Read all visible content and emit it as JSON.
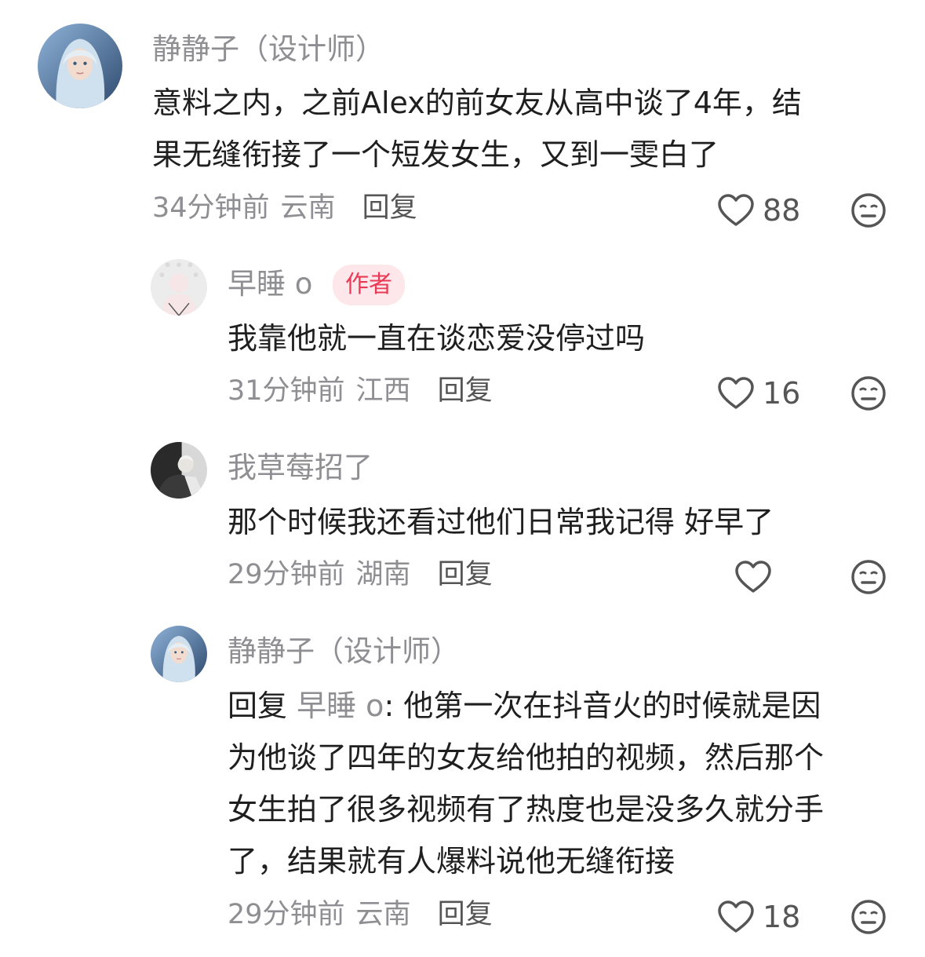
{
  "comments": [
    {
      "username": "静静子（设计师）",
      "text_lines": [
        "意料之内，之前Alex的前女友从高中谈了4年，结",
        "果无缝衔接了一个短发女生，又到一雯白了"
      ],
      "time": "34分钟前",
      "location": "云南",
      "reply_label": "回复",
      "likes": "88",
      "like_icon": "heart-outline-icon",
      "dislike_icon": "meh-face-icon"
    },
    {
      "username": "早睡 o",
      "badge": "作者",
      "text_lines": [
        "我靠他就一直在谈恋爱没停过吗"
      ],
      "time": "31分钟前",
      "location": "江西",
      "reply_label": "回复",
      "likes": "16"
    },
    {
      "username": "我草莓招了",
      "text_lines": [
        "那个时候我还看过他们日常我记得 好早了"
      ],
      "time": "29分钟前",
      "location": "湖南",
      "reply_label": "回复",
      "likes": ""
    },
    {
      "username": "静静子（设计师）",
      "reply_prefix": "回复 ",
      "reply_target": "早睡 o",
      "text_lines": [
        ": 他第一次在抖音火的时候就是因",
        "为他谈了四年的女友给他拍的视频，然后那个",
        "女生拍了很多视频有了热度也是没多久就分手",
        "了，结果就有人爆料说他无缝衔接"
      ],
      "time": "29分钟前",
      "location": "云南",
      "reply_label": "回复",
      "likes": "18"
    }
  ]
}
